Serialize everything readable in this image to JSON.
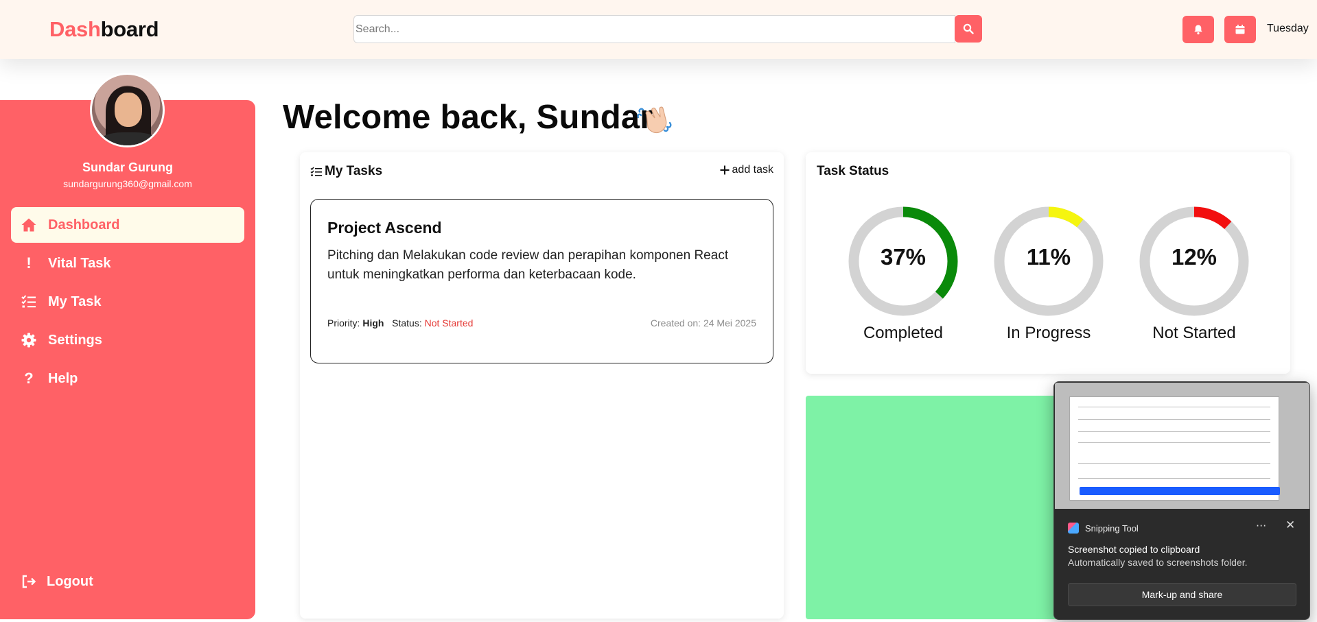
{
  "header": {
    "brand_accent": "Dash",
    "brand_rest": "board",
    "search_placeholder": "Search...",
    "day": "Tuesday",
    "accent_color": "#ff6166"
  },
  "sidebar": {
    "user_name": "Sundar Gurung",
    "user_email": "sundargurung360@gmail.com",
    "items": [
      {
        "label": "Dashboard",
        "icon": "home-icon",
        "active": true
      },
      {
        "label": "Vital Task",
        "icon": "exclamation-icon",
        "active": false
      },
      {
        "label": "My Task",
        "icon": "checklist-icon",
        "active": false
      },
      {
        "label": "Settings",
        "icon": "gear-icon",
        "active": false
      },
      {
        "label": "Help",
        "icon": "question-icon",
        "active": false
      }
    ],
    "logout_label": "Logout",
    "background_color": "#ff6166"
  },
  "main": {
    "welcome": "Welcome back, Sundar",
    "tasks": {
      "title": "My Tasks",
      "add_label": "add task",
      "items": [
        {
          "title": "Project Ascend",
          "description": "Pitching dan Melakukan code review dan perapihan komponen React untuk meningkatkan performa dan keterbacaan kode.",
          "priority_label": "Priority:",
          "priority": "High",
          "status_label": "Status:",
          "status": "Not Started",
          "created": "Created on: 24 Mei 2025"
        }
      ]
    },
    "task_status": {
      "title": "Task Status",
      "items": [
        {
          "percent": "37%",
          "value": 37,
          "label": "Completed",
          "color": "#0a8a0a"
        },
        {
          "percent": "11%",
          "value": 11,
          "label": "In Progress",
          "color": "#f5f50f"
        },
        {
          "percent": "12%",
          "value": 12,
          "label": "Not Started",
          "color": "#f20f0f"
        }
      ],
      "track_color": "#d3d3d3"
    },
    "panel_color": "#7ef2a6"
  },
  "toast": {
    "app_name": "Snipping Tool",
    "more_symbol": "···",
    "close_symbol": "✕",
    "heading": "Screenshot copied to clipboard",
    "subtext": "Automatically saved to screenshots folder.",
    "action_label": "Mark-up and share"
  }
}
